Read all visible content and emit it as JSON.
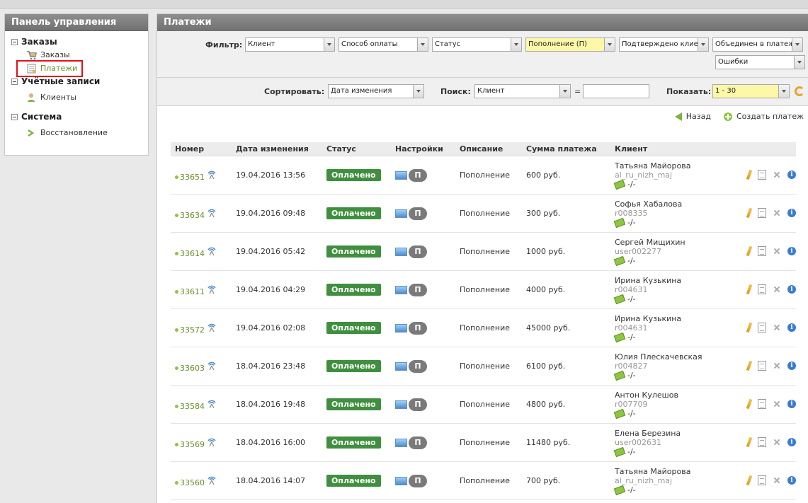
{
  "sidebar": {
    "title": "Панель управления",
    "sections": [
      {
        "label": "Заказы",
        "items": [
          {
            "label": "Заказы"
          },
          {
            "label": "Платежи"
          }
        ]
      },
      {
        "label": "Учётные записи",
        "items": [
          {
            "label": "Клиенты"
          }
        ]
      },
      {
        "label": "Система",
        "items": [
          {
            "label": "Восстановление"
          }
        ]
      }
    ]
  },
  "main": {
    "title": "Платежи",
    "filter": {
      "label": "Фильтр:",
      "client": "Клиент",
      "payment_method": "Способ оплаты",
      "status": "Статус",
      "type": "Пополнение (П)",
      "confirmed": "Подтверждено клиен",
      "combined": "Объединен в платеже",
      "errors": "Ошибки"
    },
    "sort": {
      "label": "Сортировать:",
      "value": "Дата изменения",
      "search_label": "Поиск:",
      "search_field": "Клиент",
      "equals": "=",
      "search_value": "",
      "show_label": "Показать:",
      "show_value": "1 - 30"
    },
    "actions": {
      "back": "Назад",
      "create": "Создать платеж"
    },
    "columns": [
      "Номер",
      "Дата изменения",
      "Статус",
      "Настройки",
      "Описание",
      "Сумма платежа",
      "Клиент"
    ],
    "rows": [
      {
        "num": "33651",
        "date": "19.04.2016 13:56",
        "status": "Оплачено",
        "setting": "П",
        "desc": "Пополнение",
        "sum": "600 руб.",
        "name": "Татьяна Майорова",
        "login": "al_ru_nizh_maj",
        "cash": "-/-"
      },
      {
        "num": "33634",
        "date": "19.04.2016 09:48",
        "status": "Оплачено",
        "setting": "П",
        "desc": "Пополнение",
        "sum": "300 руб.",
        "name": "Софья Хабалова",
        "login": "r008335",
        "cash": "-/-"
      },
      {
        "num": "33614",
        "date": "19.04.2016 05:42",
        "status": "Оплачено",
        "setting": "П",
        "desc": "Пополнение",
        "sum": "1000 руб.",
        "name": "Сергей Мищихин",
        "login": "user002277",
        "cash": "-/-"
      },
      {
        "num": "33611",
        "date": "19.04.2016 04:29",
        "status": "Оплачено",
        "setting": "П",
        "desc": "Пополнение",
        "sum": "4000 руб.",
        "name": "Ирина Кузькина",
        "login": "r004631",
        "cash": "-/-"
      },
      {
        "num": "33572",
        "date": "19.04.2016 02:08",
        "status": "Оплачено",
        "setting": "П",
        "desc": "Пополнение",
        "sum": "45000 руб.",
        "name": "Ирина Кузькина",
        "login": "r004631",
        "cash": "-/-"
      },
      {
        "num": "33603",
        "date": "18.04.2016 23:48",
        "status": "Оплачено",
        "setting": "П",
        "desc": "Пополнение",
        "sum": "6100 руб.",
        "name": "Юлия Плескачевская",
        "login": "r004827",
        "cash": "-/-"
      },
      {
        "num": "33584",
        "date": "18.04.2016 19:48",
        "status": "Оплачено",
        "setting": "П",
        "desc": "Пополнение",
        "sum": "4800 руб.",
        "name": "Антон Кулешов",
        "login": "r007709",
        "cash": "-/-"
      },
      {
        "num": "33569",
        "date": "18.04.2016 16:00",
        "status": "Оплачено",
        "setting": "П",
        "desc": "Пополнение",
        "sum": "11480 руб.",
        "name": "Елена Березина",
        "login": "user002631",
        "cash": "-/-"
      },
      {
        "num": "33560",
        "date": "18.04.2016 14:07",
        "status": "Оплачено",
        "setting": "П",
        "desc": "Пополнение",
        "sum": "700 руб.",
        "name": "Татьяна Майорова",
        "login": "al_ru_nizh_maj",
        "cash": "-/-"
      }
    ]
  },
  "colors": {
    "accent_green": "#6a8f2a",
    "status_green": "#3f8f3f",
    "highlight_yellow": "#fdf7a8",
    "selection_red": "#e0101a"
  }
}
